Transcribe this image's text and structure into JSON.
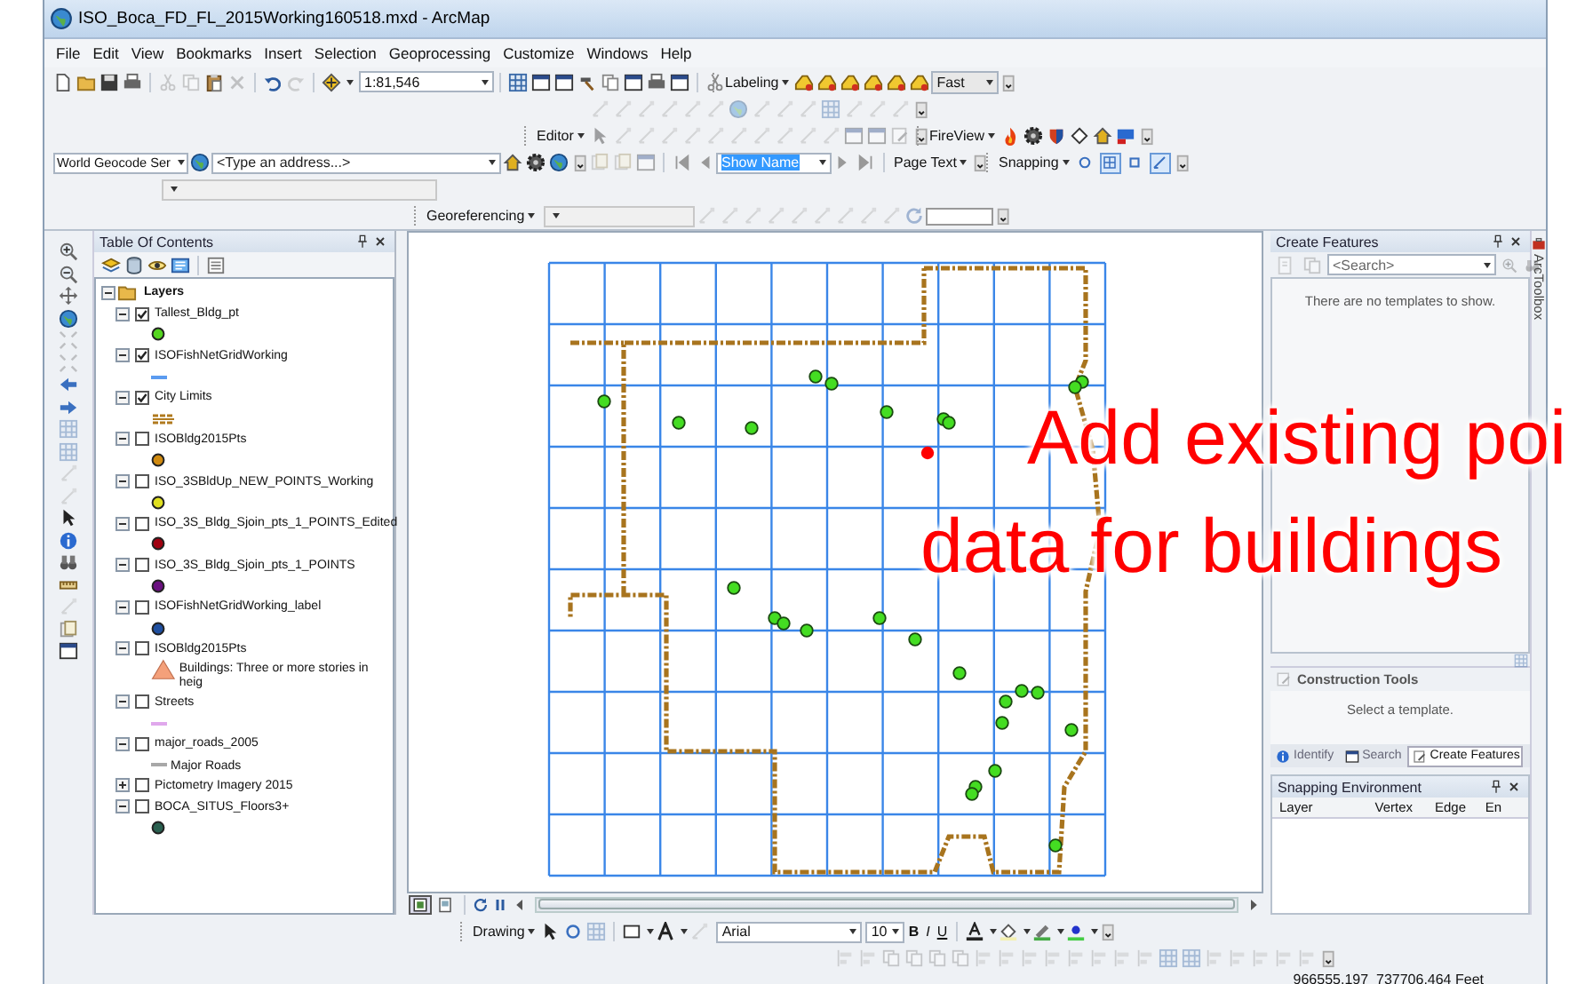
{
  "window": {
    "title": "ISO_Boca_FD_FL_2015Working160518.mxd - ArcMap"
  },
  "menu": [
    "File",
    "Edit",
    "View",
    "Bookmarks",
    "Insert",
    "Selection",
    "Geoprocessing",
    "Customize",
    "Windows",
    "Help"
  ],
  "toolbars": {
    "map_scale": "1:81,546",
    "labeling": "Labeling",
    "label_quality": "Fast",
    "editor": "Editor",
    "fireview": "FireView",
    "geocoder": "World Geocode Ser",
    "address_search": {
      "placeholder": "<Type an address...>"
    },
    "page_name": "Show Name",
    "page_text": "Page Text",
    "snapping": "Snapping",
    "snapping_toggles": [
      {
        "on": false
      },
      {
        "on": true
      },
      {
        "on": false
      },
      {
        "on": true
      }
    ],
    "georeferencing": "Georeferencing"
  },
  "table_of_contents": {
    "title": "Table Of Contents",
    "root": {
      "label": "Layers",
      "expanded": true,
      "children": [
        {
          "name": "Tallest_Bldg_pt",
          "checked": true,
          "expanded": true,
          "legend": {
            "kind": "point",
            "color": "#55d620"
          }
        },
        {
          "name": "ISOFishNetGridWorking",
          "checked": true,
          "expanded": true,
          "legend": {
            "kind": "line",
            "color": "#5b9bf0"
          }
        },
        {
          "name": "City Limits",
          "checked": true,
          "expanded": true,
          "legend": {
            "kind": "boundary",
            "color": "#b07a1e"
          }
        },
        {
          "name": "ISOBldg2015Pts",
          "checked": false,
          "expanded": true,
          "legend": {
            "kind": "point",
            "color": "#d08a10"
          }
        },
        {
          "name": "ISO_3SBldUp_NEW_POINTS_Working",
          "checked": false,
          "expanded": true,
          "legend": {
            "kind": "point",
            "color": "#e0e020"
          }
        },
        {
          "name": "ISO_3S_Bldg_Sjoin_pts_1_POINTS_Edited",
          "checked": false,
          "expanded": true,
          "legend": {
            "kind": "point",
            "color": "#a00010"
          }
        },
        {
          "name": "ISO_3S_Bldg_Sjoin_pts_1_POINTS",
          "checked": false,
          "expanded": true,
          "legend": {
            "kind": "point",
            "color": "#6a1080"
          }
        },
        {
          "name": "ISOFishNetGridWorking_label",
          "checked": false,
          "expanded": true,
          "legend": {
            "kind": "point",
            "color": "#1f4fa0"
          }
        },
        {
          "name": "ISOBldg2015Pts",
          "checked": false,
          "expanded": true,
          "legend": {
            "kind": "triangle",
            "color": "#f4a07a",
            "label": "Buildings: Three or more stories in heig"
          }
        },
        {
          "name": "Streets",
          "checked": false,
          "expanded": true,
          "legend": {
            "kind": "line",
            "color": "#e0a8ec"
          }
        },
        {
          "name": "major_roads_2005",
          "checked": false,
          "expanded": true,
          "legend": {
            "kind": "line",
            "color": "#a8a8a8",
            "label": "Major Roads"
          }
        },
        {
          "name": "Pictometry Imagery 2015",
          "checked": false,
          "expanded": false
        },
        {
          "name": "BOCA_SITUS_Floors3+",
          "checked": false,
          "expanded": true,
          "legend": {
            "kind": "point",
            "color": "#2a6050"
          }
        }
      ]
    }
  },
  "map": {
    "annotation": [
      "Add existing poi",
      "data for buildings"
    ]
  },
  "create_features": {
    "title": "Create Features",
    "search": {
      "placeholder": "<Search>"
    },
    "message": "There are no templates to show.",
    "construction_tools": {
      "title": "Construction Tools",
      "message": "Select a template."
    },
    "tabs": [
      {
        "label": "Identify",
        "selected": false
      },
      {
        "label": "Search",
        "selected": false
      },
      {
        "label": "Create Features",
        "selected": true
      }
    ]
  },
  "snapping_environment": {
    "title": "Snapping Environment",
    "columns": [
      "Layer",
      "Vertex",
      "Edge",
      "En"
    ]
  },
  "side_tab": "ArcToolbox",
  "drawing_toolbar": {
    "label": "Drawing",
    "font": "Arial",
    "font_size": "10",
    "styles": [
      "B",
      "I",
      "U"
    ]
  },
  "status_bar": {
    "coordinates": "966555.197  737706.464 Feet"
  }
}
